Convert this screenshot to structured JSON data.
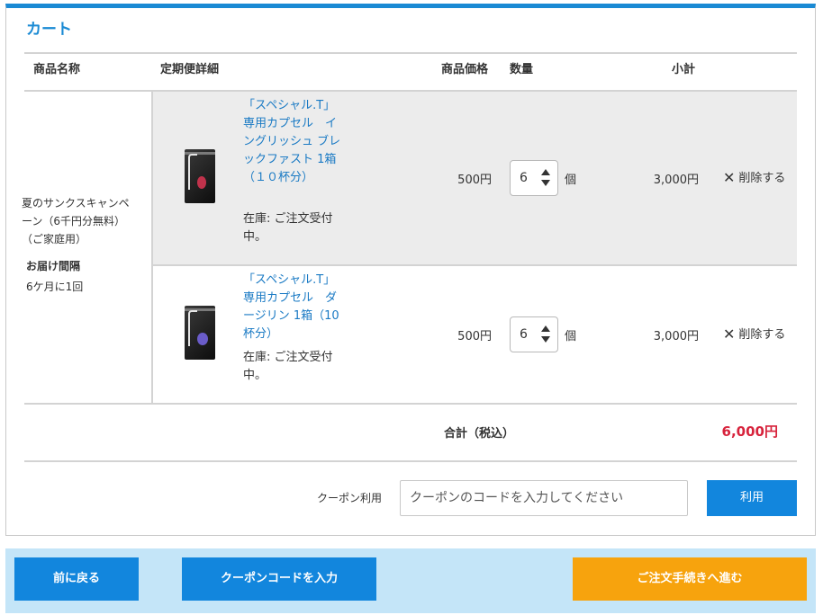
{
  "cart": {
    "title": "カート",
    "headers": {
      "product_name": "商品名称",
      "subscription_detail": "定期便詳細",
      "price": "商品価格",
      "quantity": "数量",
      "subtotal": "小計"
    },
    "campaign": {
      "name": "夏のサンクスキャンペーン（6千円分無料）（ご家庭用）",
      "interval_label": "お届け間隔",
      "interval_value": "6ケ月に1回"
    },
    "items": [
      {
        "name": "「スペシャル.T」専用カプセル　イングリッシュ ブレックファスト 1箱　（１０杯分）",
        "stock": "在庫: ご注文受付中。",
        "price": "500円",
        "quantity": "6",
        "unit": "個",
        "subtotal": "3,000円",
        "delete_label": "削除する",
        "image_icon": "tea-capsule-box-red"
      },
      {
        "name": "「スペシャル.T」専用カプセル　ダージリン 1箱（10杯分）",
        "stock": "在庫: ご注文受付中。",
        "price": "500円",
        "quantity": "6",
        "unit": "個",
        "subtotal": "3,000円",
        "delete_label": "削除する",
        "image_icon": "tea-capsule-box-purple"
      }
    ],
    "total": {
      "label": "合計（税込）",
      "value": "6,000円"
    },
    "coupon": {
      "label": "クーポン利用",
      "placeholder": "クーポンのコードを入力してください",
      "apply_label": "利用"
    }
  },
  "footer": {
    "back_label": "前に戻る",
    "coupon_code_label": "クーポンコードを入力",
    "checkout_label": "ご注文手続きへ進む"
  },
  "colors": {
    "accent_blue": "#1286dd",
    "title_blue": "#1a8ad4",
    "link_blue": "#1a7ac4",
    "total_red": "#d7233c",
    "checkout_orange": "#f7a30d",
    "footer_bg": "#c4e5f8"
  }
}
